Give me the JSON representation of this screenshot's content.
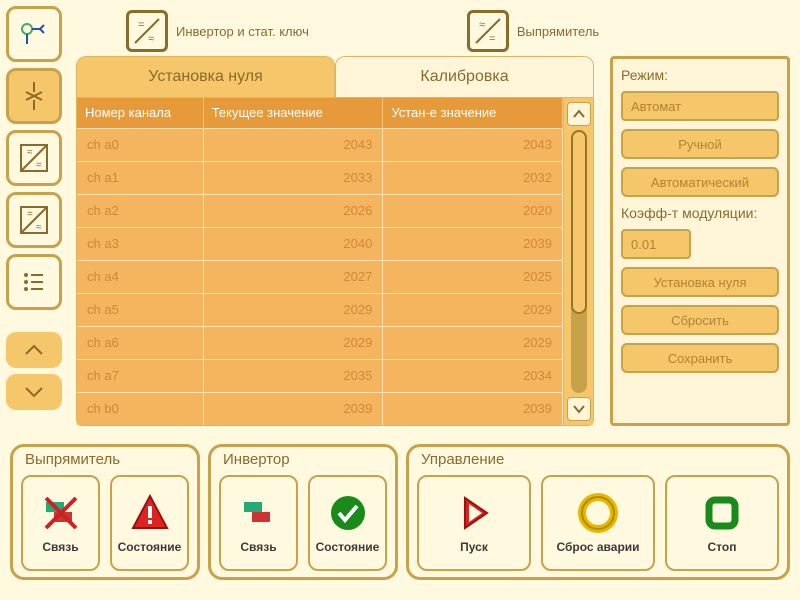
{
  "device_tabs": {
    "inverter": "Инвертор и стат. ключ",
    "rectifier": "Выпрямитель",
    "active": "inverter"
  },
  "table_tabs": {
    "zero": "Установка нуля",
    "calib": "Калибровка",
    "active": "zero"
  },
  "columns": {
    "channel": "Номер канала",
    "current": "Текущее значение",
    "set": "Устан-е значение"
  },
  "rows": [
    {
      "ch": "ch a0",
      "cur": 2043,
      "set": 2043
    },
    {
      "ch": "ch a1",
      "cur": 2033,
      "set": 2032
    },
    {
      "ch": "ch a2",
      "cur": 2026,
      "set": 2020
    },
    {
      "ch": "ch a3",
      "cur": 2040,
      "set": 2039
    },
    {
      "ch": "ch a4",
      "cur": 2027,
      "set": 2025
    },
    {
      "ch": "ch a5",
      "cur": 2029,
      "set": 2029
    },
    {
      "ch": "ch a6",
      "cur": 2029,
      "set": 2029
    },
    {
      "ch": "ch a7",
      "cur": 2035,
      "set": 2034
    },
    {
      "ch": "ch b0",
      "cur": 2039,
      "set": 2039
    }
  ],
  "side": {
    "mode_label": "Режим:",
    "mode_value": "Автомат",
    "manual_btn": "Ручной",
    "auto_btn": "Автоматический",
    "coef_label": "Коэфф-т модуляции:",
    "coef_value": "0.01",
    "zero_btn": "Установка нуля",
    "reset_btn": "Сбросить",
    "save_btn": "Сохранить"
  },
  "bottom": {
    "rect_title": "Выпрямитель",
    "inv_title": "Инвертор",
    "ctrl_title": "Управление",
    "link": "Связь",
    "state": "Состояние",
    "start": "Пуск",
    "alarm_reset": "Сброс аварии",
    "stop": "Стоп"
  }
}
